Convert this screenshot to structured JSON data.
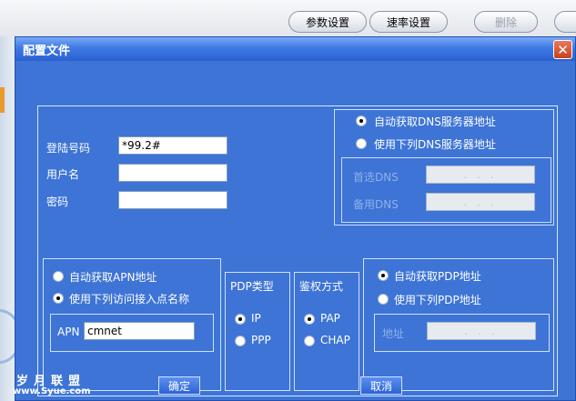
{
  "toolbar": {
    "param_settings": "参数设置",
    "rate_settings": "速率设置",
    "delete": "删除"
  },
  "dialog": {
    "title": "配置文件",
    "close_glyph": "✕"
  },
  "login": {
    "phone_label": "登陆号码",
    "phone_value": "*99.2#",
    "user_label": "用户名",
    "user_value": "",
    "password_label": "密码",
    "password_value": ""
  },
  "dns": {
    "auto_label": "自动获取DNS服务器地址",
    "manual_label": "使用下列DNS服务器地址",
    "primary_label": "首选DNS",
    "secondary_label": "备用DNS",
    "primary_value": ". . .",
    "secondary_value": ". . ."
  },
  "apn": {
    "auto_label": "自动获取APN地址",
    "manual_label": "使用下列访问接入点名称",
    "apn_label": "APN",
    "apn_value": "cmnet"
  },
  "pdp_type": {
    "title": "PDP类型",
    "ip": "IP",
    "ppp": "PPP"
  },
  "auth": {
    "title": "鉴权方式",
    "pap": "PAP",
    "chap": "CHAP"
  },
  "pdp_addr": {
    "auto_label": "自动获取PDP地址",
    "manual_label": "使用下列PDP地址",
    "addr_label": "地址",
    "addr_value": ". . ."
  },
  "buttons": {
    "ok": "确定",
    "cancel": "取消"
  },
  "watermark": {
    "cn": "岁月联盟",
    "url": "www.Syue.com"
  },
  "colors": {
    "dialog_bg": "#3d74d6",
    "titlebar": "#2a60d1",
    "close": "#c8401d"
  }
}
